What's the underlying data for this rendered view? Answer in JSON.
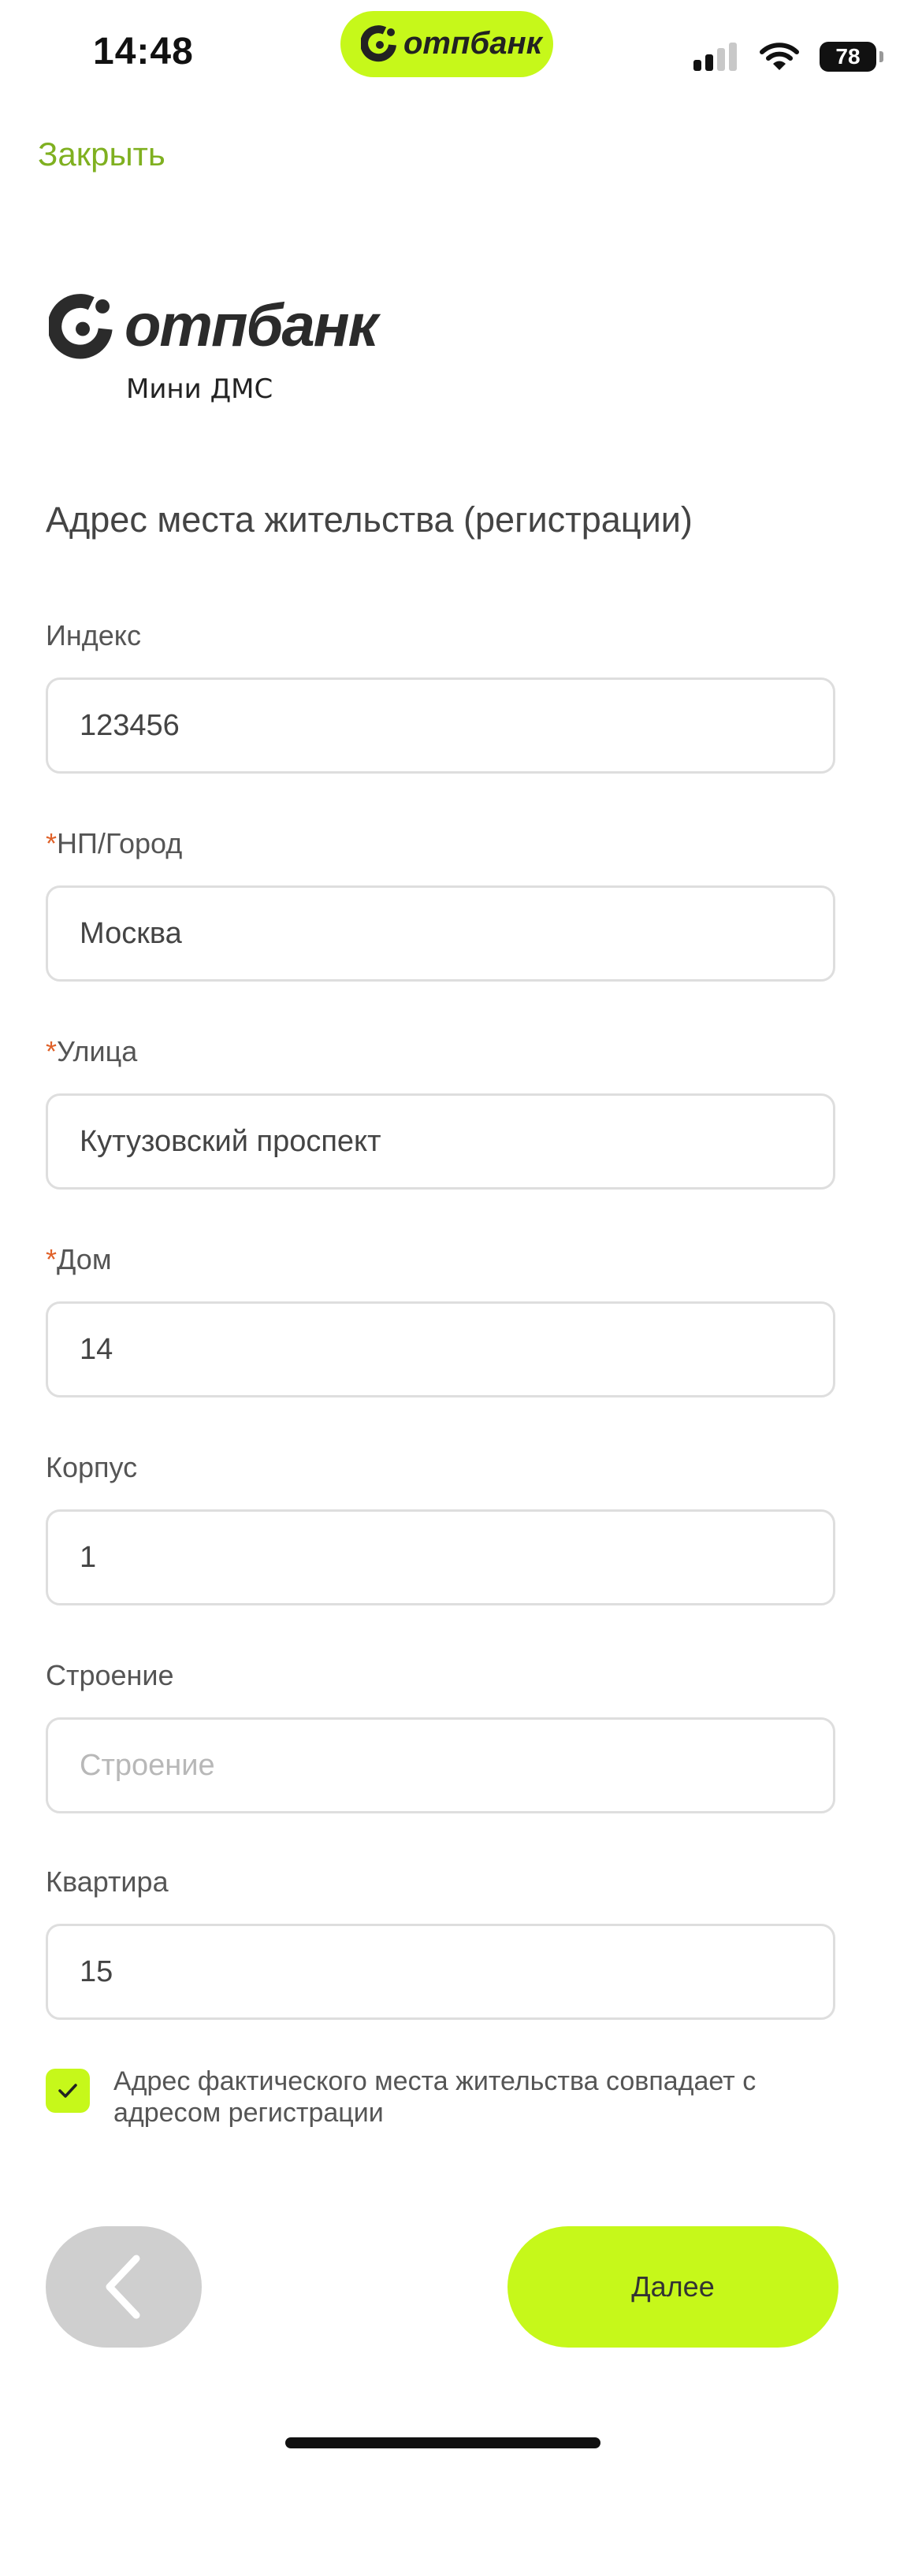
{
  "status_bar": {
    "time": "14:48",
    "pill_brand": "отпбанк",
    "battery": "78"
  },
  "header": {
    "close_label": "Закрыть"
  },
  "brand": {
    "name": "отпбанк",
    "subtitle": "Мини ДМС"
  },
  "section_title": "Адрес места жительства (регистрации)",
  "fields": [
    {
      "label": "Индекс",
      "required": false,
      "value": "123456",
      "placeholder": ""
    },
    {
      "label": "НП/Город",
      "required": true,
      "value": "Москва",
      "placeholder": ""
    },
    {
      "label": "Улица",
      "required": true,
      "value": "Кутузовский проспект",
      "placeholder": ""
    },
    {
      "label": "Дом",
      "required": true,
      "value": "14",
      "placeholder": ""
    },
    {
      "label": "Корпус",
      "required": false,
      "value": "1",
      "placeholder": ""
    },
    {
      "label": "Строение",
      "required": false,
      "value": "",
      "placeholder": "Строение"
    },
    {
      "label": "Квартира",
      "required": false,
      "value": "15",
      "placeholder": ""
    }
  ],
  "required_mark": "*",
  "same_address": {
    "checked": true,
    "label": "Адрес фактического места жительства совпадает с адресом регистрации"
  },
  "footer": {
    "next_label": "Далее"
  },
  "colors": {
    "accent": "#c6f81a",
    "link": "#7fb020",
    "required": "#e0622a",
    "back_button": "#cfcfcf"
  },
  "icons": [
    "otp-logo-icon",
    "signal-icon",
    "wifi-icon",
    "battery-icon",
    "checkmark-icon",
    "chevron-left-icon"
  ]
}
